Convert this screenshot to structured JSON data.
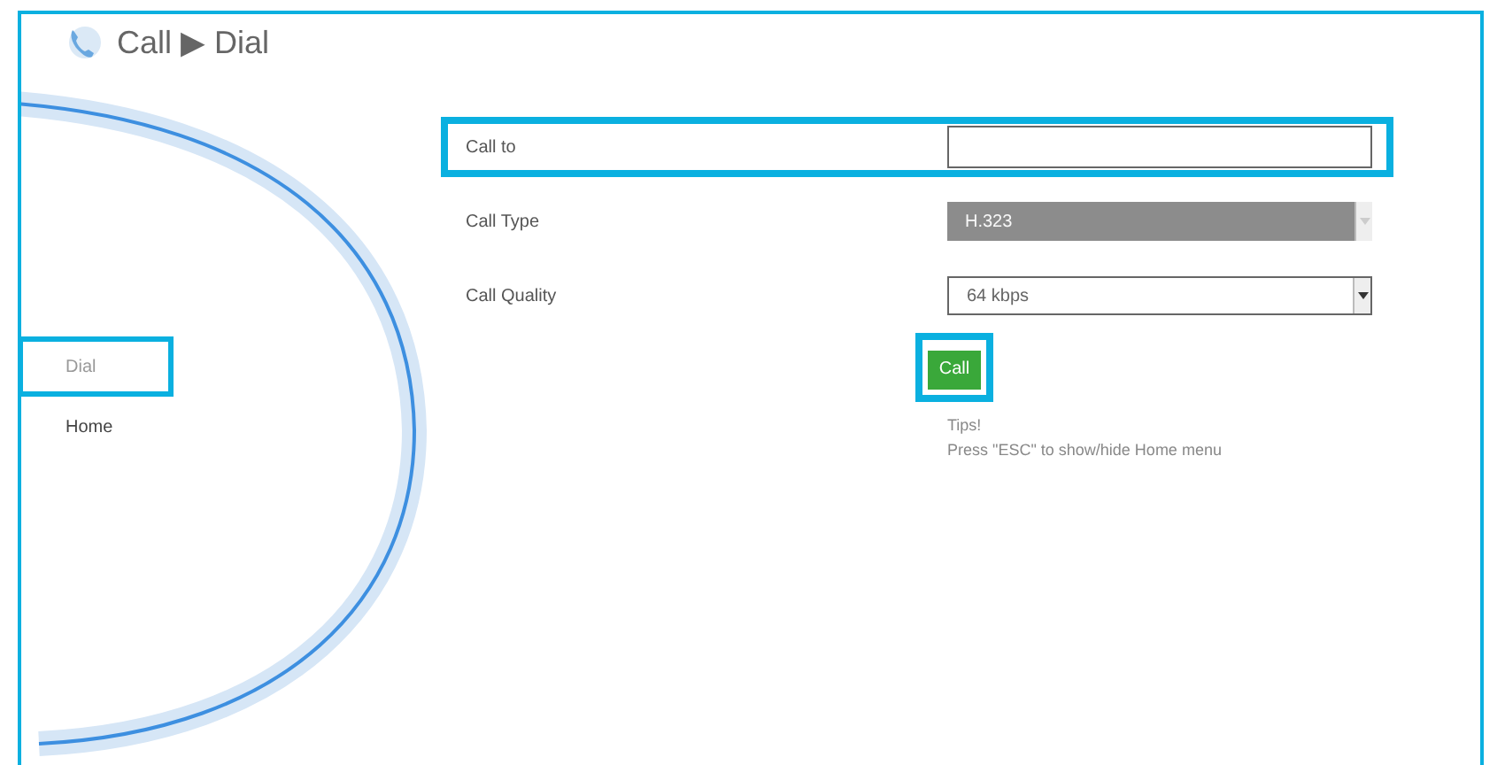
{
  "header": {
    "title": "Call ▶ Dial"
  },
  "menu": [
    {
      "label": "Dial",
      "selected": true,
      "highlighted": true
    },
    {
      "label": "Home",
      "selected": false,
      "highlighted": false
    }
  ],
  "form": [
    {
      "kind": "input",
      "label": "Call to",
      "highlighted": true,
      "disabled": false
    },
    {
      "kind": "select",
      "label": "Call Type",
      "value": "H.323",
      "highlighted": false,
      "disabled": true
    },
    {
      "kind": "select",
      "label": "Call Quality",
      "value": "64 kbps",
      "highlighted": false,
      "disabled": false
    }
  ],
  "call_button": {
    "label": "Call",
    "highlighted": true
  },
  "tips": [
    "Tips!",
    "Press \"ESC\" to show/hide Home menu"
  ]
}
